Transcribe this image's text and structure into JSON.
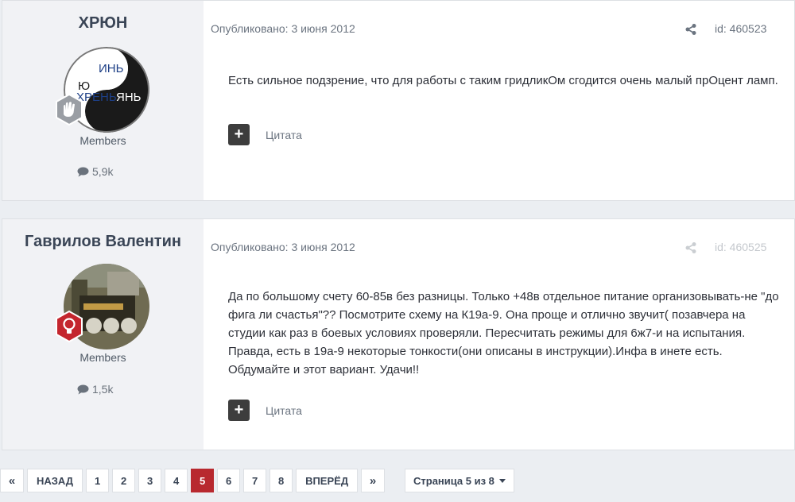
{
  "posts": [
    {
      "author": "ХРЮН",
      "avatar_text": [
        "ИНЬ",
        "Ю",
        "ХРЕНЬ",
        "ЯНЬ"
      ],
      "group": "Members",
      "post_count": "5,9k",
      "published": "Опубликовано: 3 июня 2012",
      "id": "id: 460523",
      "content": "Есть сильное подзрение, что для работы с таким гридликОм сгодится очень малый прОцент ламп.",
      "quote_label": "Цитата"
    },
    {
      "author": "Гаврилов Валентин",
      "group": "Members",
      "post_count": "1,5k",
      "published": "Опубликовано: 3 июня 2012",
      "id": "id: 460525",
      "content": "Да по большому счету 60-85в без разницы. Только +48в отдельное питание организовывать-не \"до фига ли счастья\"?? Посмотрите схему на К19а-9. Она проще и отлично звучит( позавчера на студии как раз в боевых условиях проверяли. Пересчитать режимы для 6ж7-и на испытания. Правда, есть в 19а-9 некоторые тонкости(они описаны в инструкции).Инфа в инете есть. Обдумайте и этот вариант. Удачи!!",
      "quote_label": "Цитата"
    }
  ],
  "pagination": {
    "first": "«",
    "prev": "НАЗАД",
    "pages": [
      "1",
      "2",
      "3",
      "4",
      "5",
      "6",
      "7",
      "8"
    ],
    "current": "5",
    "next": "ВПЕРЁД",
    "last": "»",
    "page_select": "Страница 5 из 8"
  },
  "icons": {
    "share": "share-icon",
    "comment": "comment-icon",
    "quote": "plus-icon",
    "caret": "chevron-down-icon"
  },
  "colors": {
    "accent": "#b8292f",
    "author_bg": "#f1f2f5",
    "page_bg": "#ebeef2"
  }
}
